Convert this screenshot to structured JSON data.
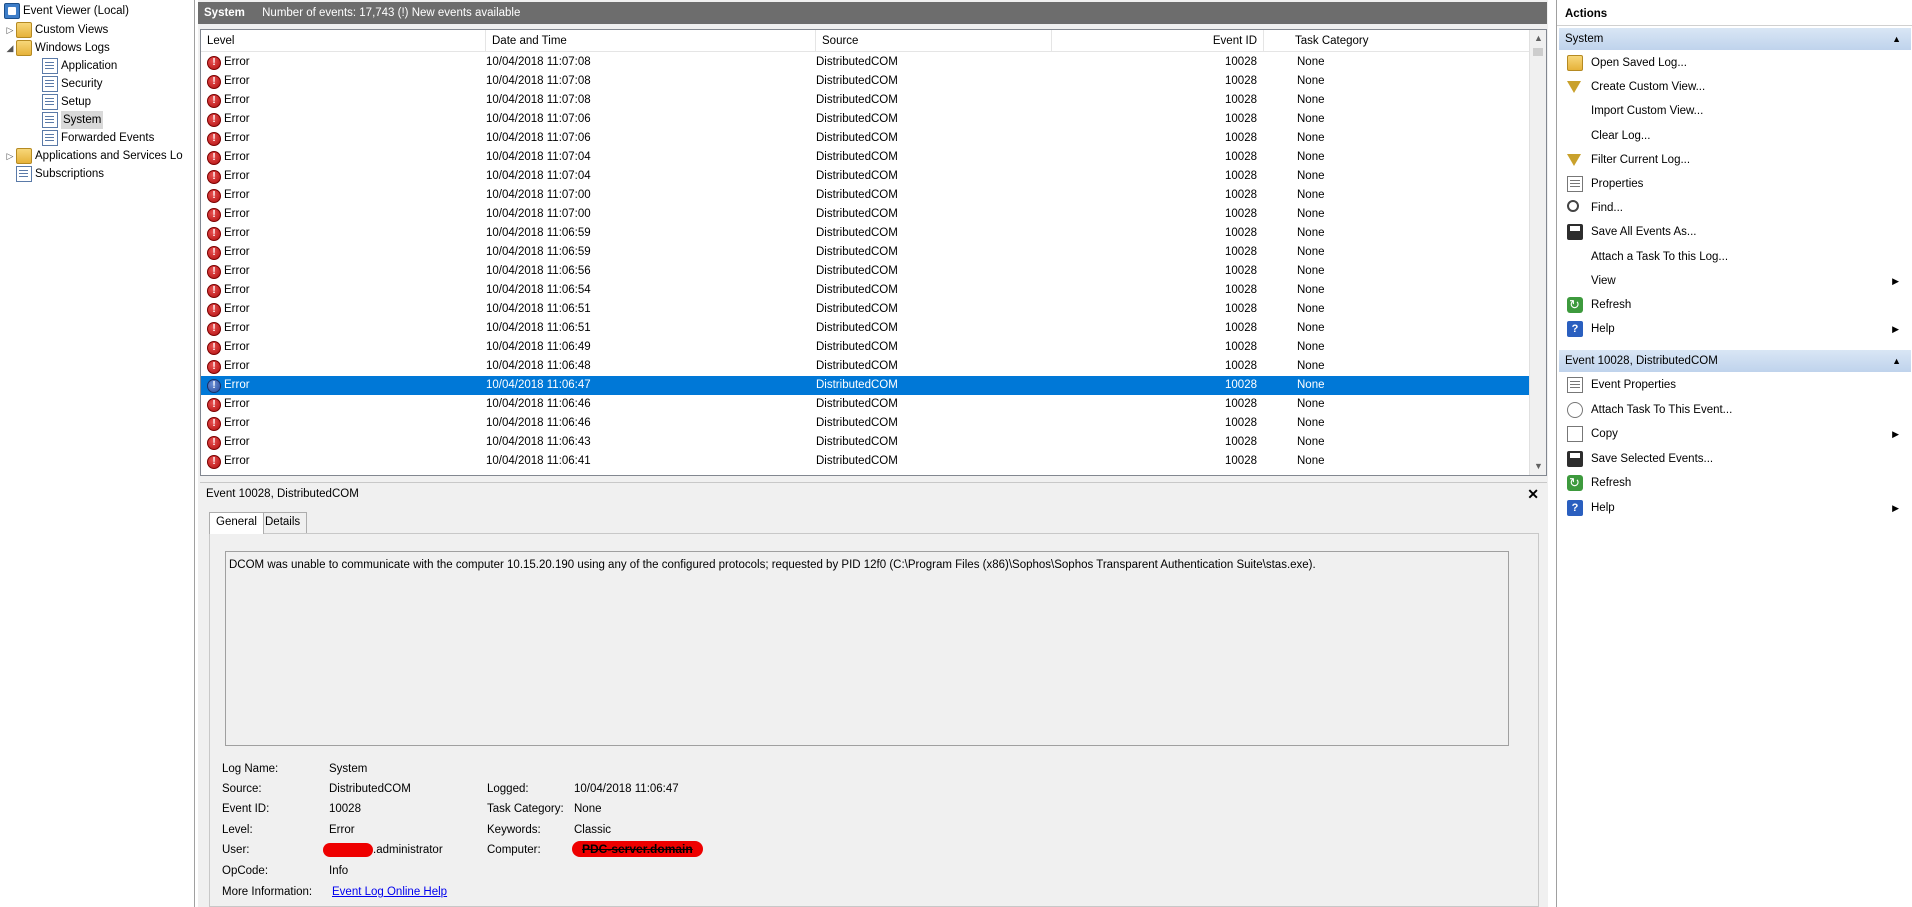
{
  "tree": {
    "root": "Event Viewer (Local)",
    "custom_views": "Custom Views",
    "windows_logs": "Windows Logs",
    "logs": [
      "Application",
      "Security",
      "Setup",
      "System",
      "Forwarded Events"
    ],
    "apps_services": "Applications and Services Lo",
    "subscriptions": "Subscriptions"
  },
  "header": {
    "title": "System",
    "info": "Number of events: 17,743 (!) New events available"
  },
  "grid": {
    "columns": [
      "Level",
      "Date and Time",
      "Source",
      "Event ID",
      "Task Category"
    ],
    "selected_index": 17,
    "rows": [
      {
        "level": "Error",
        "date": "10/04/2018 11:07:08",
        "source": "DistributedCOM",
        "id": "10028",
        "cat": "None"
      },
      {
        "level": "Error",
        "date": "10/04/2018 11:07:08",
        "source": "DistributedCOM",
        "id": "10028",
        "cat": "None"
      },
      {
        "level": "Error",
        "date": "10/04/2018 11:07:08",
        "source": "DistributedCOM",
        "id": "10028",
        "cat": "None"
      },
      {
        "level": "Error",
        "date": "10/04/2018 11:07:06",
        "source": "DistributedCOM",
        "id": "10028",
        "cat": "None"
      },
      {
        "level": "Error",
        "date": "10/04/2018 11:07:06",
        "source": "DistributedCOM",
        "id": "10028",
        "cat": "None"
      },
      {
        "level": "Error",
        "date": "10/04/2018 11:07:04",
        "source": "DistributedCOM",
        "id": "10028",
        "cat": "None"
      },
      {
        "level": "Error",
        "date": "10/04/2018 11:07:04",
        "source": "DistributedCOM",
        "id": "10028",
        "cat": "None"
      },
      {
        "level": "Error",
        "date": "10/04/2018 11:07:00",
        "source": "DistributedCOM",
        "id": "10028",
        "cat": "None"
      },
      {
        "level": "Error",
        "date": "10/04/2018 11:07:00",
        "source": "DistributedCOM",
        "id": "10028",
        "cat": "None"
      },
      {
        "level": "Error",
        "date": "10/04/2018 11:06:59",
        "source": "DistributedCOM",
        "id": "10028",
        "cat": "None"
      },
      {
        "level": "Error",
        "date": "10/04/2018 11:06:59",
        "source": "DistributedCOM",
        "id": "10028",
        "cat": "None"
      },
      {
        "level": "Error",
        "date": "10/04/2018 11:06:56",
        "source": "DistributedCOM",
        "id": "10028",
        "cat": "None"
      },
      {
        "level": "Error",
        "date": "10/04/2018 11:06:54",
        "source": "DistributedCOM",
        "id": "10028",
        "cat": "None"
      },
      {
        "level": "Error",
        "date": "10/04/2018 11:06:51",
        "source": "DistributedCOM",
        "id": "10028",
        "cat": "None"
      },
      {
        "level": "Error",
        "date": "10/04/2018 11:06:51",
        "source": "DistributedCOM",
        "id": "10028",
        "cat": "None"
      },
      {
        "level": "Error",
        "date": "10/04/2018 11:06:49",
        "source": "DistributedCOM",
        "id": "10028",
        "cat": "None"
      },
      {
        "level": "Error",
        "date": "10/04/2018 11:06:48",
        "source": "DistributedCOM",
        "id": "10028",
        "cat": "None"
      },
      {
        "level": "Error",
        "date": "10/04/2018 11:06:47",
        "source": "DistributedCOM",
        "id": "10028",
        "cat": "None"
      },
      {
        "level": "Error",
        "date": "10/04/2018 11:06:46",
        "source": "DistributedCOM",
        "id": "10028",
        "cat": "None"
      },
      {
        "level": "Error",
        "date": "10/04/2018 11:06:46",
        "source": "DistributedCOM",
        "id": "10028",
        "cat": "None"
      },
      {
        "level": "Error",
        "date": "10/04/2018 11:06:43",
        "source": "DistributedCOM",
        "id": "10028",
        "cat": "None"
      },
      {
        "level": "Error",
        "date": "10/04/2018 11:06:41",
        "source": "DistributedCOM",
        "id": "10028",
        "cat": "None"
      }
    ]
  },
  "details": {
    "title": "Event 10028, DistributedCOM",
    "tabs": [
      "General",
      "Details"
    ],
    "description": "DCOM was unable to communicate with the computer 10.15.20.190 using any of the configured protocols; requested by PID      12f0 (C:\\Program Files (x86)\\Sophos\\Sophos Transparent Authentication Suite\\stas.exe).",
    "labels": {
      "log_name": "Log Name:",
      "source": "Source:",
      "event_id": "Event ID:",
      "level": "Level:",
      "user": "User:",
      "opcode": "OpCode:",
      "more_info": "More Information:",
      "logged": "Logged:",
      "task_category": "Task Category:",
      "keywords": "Keywords:",
      "computer": "Computer:"
    },
    "values": {
      "log_name": "System",
      "source": "DistributedCOM",
      "event_id": "10028",
      "level": "Error",
      "user": ".administrator",
      "opcode": "Info",
      "more_info": "Event Log Online Help",
      "logged": "10/04/2018 11:06:47",
      "task_category": "None",
      "keywords": "Classic",
      "computer": "PDC-server.domain"
    }
  },
  "actions": {
    "title": "Actions",
    "section1": "System",
    "items1": [
      {
        "label": "Open Saved Log...",
        "icon": "open-folder-icon"
      },
      {
        "label": "Create Custom View...",
        "icon": "filter-icon"
      },
      {
        "label": "Import Custom View...",
        "icon": ""
      },
      {
        "label": "Clear Log...",
        "icon": ""
      },
      {
        "label": "Filter Current Log...",
        "icon": "filter-icon"
      },
      {
        "label": "Properties",
        "icon": "properties-icon"
      },
      {
        "label": "Find...",
        "icon": "find-icon"
      },
      {
        "label": "Save All Events As...",
        "icon": "save-icon"
      },
      {
        "label": "Attach a Task To this Log...",
        "icon": ""
      },
      {
        "label": "View",
        "icon": ""
      },
      {
        "label": "Refresh",
        "icon": "refresh-icon"
      },
      {
        "label": "Help",
        "icon": "help-icon"
      }
    ],
    "section2": "Event 10028, DistributedCOM",
    "items2": [
      {
        "label": "Event Properties",
        "icon": "properties-icon"
      },
      {
        "label": "Attach Task To This Event...",
        "icon": "attach-task-icon"
      },
      {
        "label": "Copy",
        "icon": "copy-icon"
      },
      {
        "label": "Save Selected Events...",
        "icon": "save-icon"
      },
      {
        "label": "Refresh",
        "icon": "refresh-icon"
      },
      {
        "label": "Help",
        "icon": "help-icon"
      }
    ]
  }
}
